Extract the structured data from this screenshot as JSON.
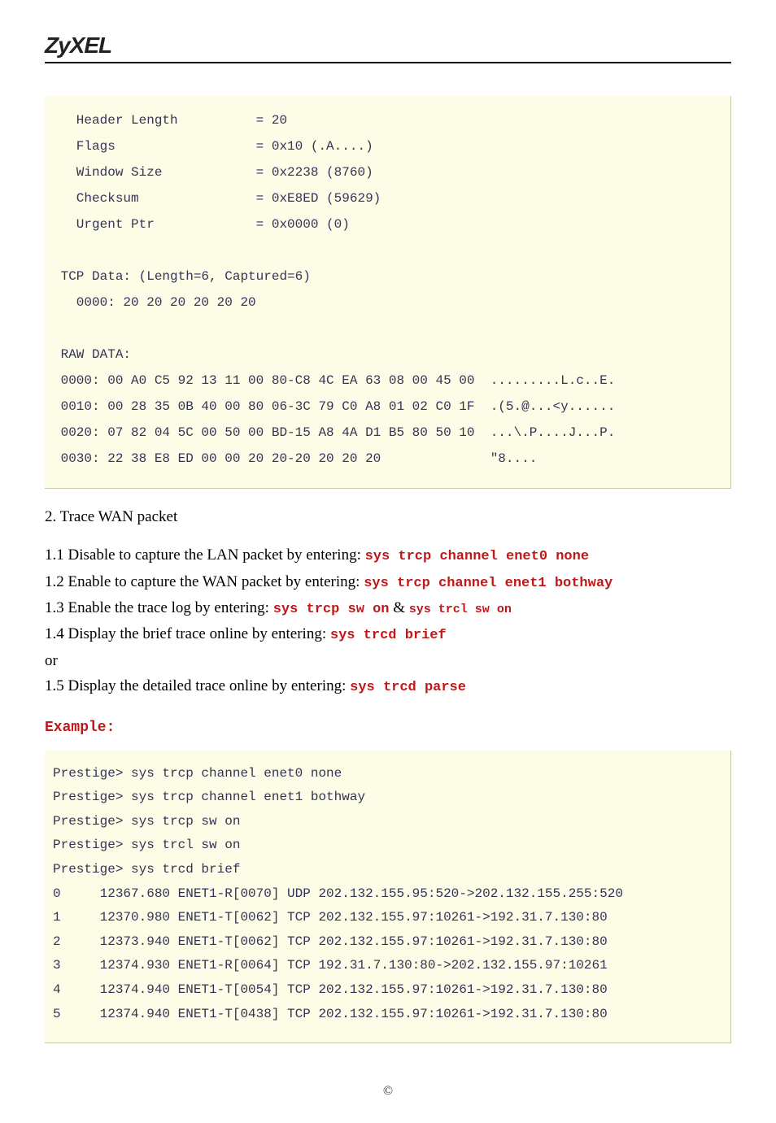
{
  "header": {
    "logo": "ZyXEL"
  },
  "codebox1": "   Header Length          = 20\n   Flags                  = 0x10 (.A....)\n   Window Size            = 0x2238 (8760)\n   Checksum               = 0xE8ED (59629)\n   Urgent Ptr             = 0x0000 (0)\n\n TCP Data: (Length=6, Captured=6)\n   0000: 20 20 20 20 20 20\n\n RAW DATA:\n 0000: 00 A0 C5 92 13 11 00 80-C8 4C EA 63 08 00 45 00  .........L.c..E.\n 0010: 00 28 35 0B 40 00 80 06-3C 79 C0 A8 01 02 C0 1F  .(5.@...<y......\n 0020: 07 82 04 5C 00 50 00 BD-15 A8 4A D1 B5 80 50 10  ...\\.P....J...P.\n 0030: 22 38 E8 ED 00 00 20 20-20 20 20 20              \"8....",
  "section2_title": "2. Trace WAN packet",
  "steps": {
    "s11_text": "1.1 Disable to capture the LAN packet by entering: ",
    "s11_cmd": "sys trcp channel enet0 none",
    "s12_text": "1.2 Enable to capture the WAN packet by entering: ",
    "s12_cmd": "sys trcp channel enet1 bothway",
    "s13_text": "1.3 Enable the trace log by entering: ",
    "s13_cmd1": "sys trcp sw on",
    "s13_amp": " & ",
    "s13_cmd2": "sys trcl sw on",
    "s14_text": "1.4 Display the brief trace online by entering: ",
    "s14_cmd": "sys trcd brief",
    "or": "or",
    "s15_text": "1.5 Display the detailed trace online by entering: ",
    "s15_cmd": "sys trcd parse"
  },
  "example_label": "Example:",
  "codebox2": "Prestige> sys trcp channel enet0 none\nPrestige> sys trcp channel enet1 bothway\nPrestige> sys trcp sw on\nPrestige> sys trcl sw on\nPrestige> sys trcd brief\n0     12367.680 ENET1-R[0070] UDP 202.132.155.95:520->202.132.155.255:520\n1     12370.980 ENET1-T[0062] TCP 202.132.155.97:10261->192.31.7.130:80\n2     12373.940 ENET1-T[0062] TCP 202.132.155.97:10261->192.31.7.130:80\n3     12374.930 ENET1-R[0064] TCP 192.31.7.130:80->202.132.155.97:10261\n4     12374.940 ENET1-T[0054] TCP 202.132.155.97:10261->192.31.7.130:80\n5     12374.940 ENET1-T[0438] TCP 202.132.155.97:10261->192.31.7.130:80",
  "footer": "©"
}
